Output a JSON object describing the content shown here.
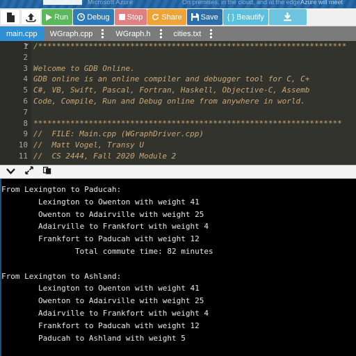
{
  "ad_banner": {
    "logo_alt": "microsoft-logo",
    "text_1": "Microsoft Azure",
    "text_2": "On premises, in the cloud, and at the edge",
    "text_3": "Azure will meet"
  },
  "toolbar": {
    "new_file_label": "",
    "upload_label": "",
    "run_label": "Run",
    "debug_label": "Debug",
    "stop_label": "Stop",
    "share_label": "Share",
    "save_label": "Save",
    "beautify_label": "{ } Beautify",
    "download_label": "",
    "colors": {
      "run": "#5cb85c",
      "debug": "#2b7cb8",
      "stop": "#e08080",
      "share": "#efa437",
      "save": "#2b6ea8",
      "beautify": "#5bc0de",
      "download": "#6cc4e0"
    }
  },
  "tabs": [
    {
      "label": "main.cpp",
      "active": true,
      "has_menu": false
    },
    {
      "label": "WGraph.cpp",
      "active": false,
      "has_menu": true
    },
    {
      "label": "WGraph.h",
      "active": false,
      "has_menu": true
    },
    {
      "label": "cities.txt",
      "active": false,
      "has_menu": true
    }
  ],
  "editor": {
    "line_numbers": [
      "1",
      "2",
      "3",
      "4",
      "5",
      "6",
      "7",
      "8",
      "9",
      "10",
      "11"
    ],
    "lines": [
      "/*******************************************************************",
      "",
      "Welcome to GDB Online.",
      "GDB online is an online compiler and debugger tool for C, C+",
      "C#, VB, Swift, Pascal, Fortran, Haskell, Objective-C, Assemb",
      "Code, Compile, Run and Debug online from anywhere in world.",
      "",
      "*******************************************************************",
      "//  FILE: Main.cpp (WGraphDriver.cpp)",
      "//  Matt Vogel, Transy U",
      "//  CS 2444, Fall 2020 Module 2"
    ],
    "comment_color": "#c9a875",
    "background": "#33332e"
  },
  "panel_bar": {
    "collapse_icon": "chevron-down-icon",
    "expand_icon": "expand-arrows-icon",
    "copy_icon": "copy-icon"
  },
  "console": {
    "lines": [
      "From Lexington to Paducah:",
      "        Lexington to Owenton with weight 41",
      "        Owenton to Adairville with weight 25",
      "        Adairville to Frankfort with weight 4",
      "        Frankfort to Paducah with weight 12",
      "                Total commute time: 82 minutes",
      "",
      "From Lexington to Ashland:",
      "        Lexington to Owenton with weight 41",
      "        Owenton to Adairville with weight 25",
      "        Adairville to Frankfort with weight 4",
      "        Frankfort to Paducah with weight 12",
      "        Paducah to Ashland with weight 5"
    ],
    "background": "#000000",
    "text_color": "#e8e8e8"
  }
}
